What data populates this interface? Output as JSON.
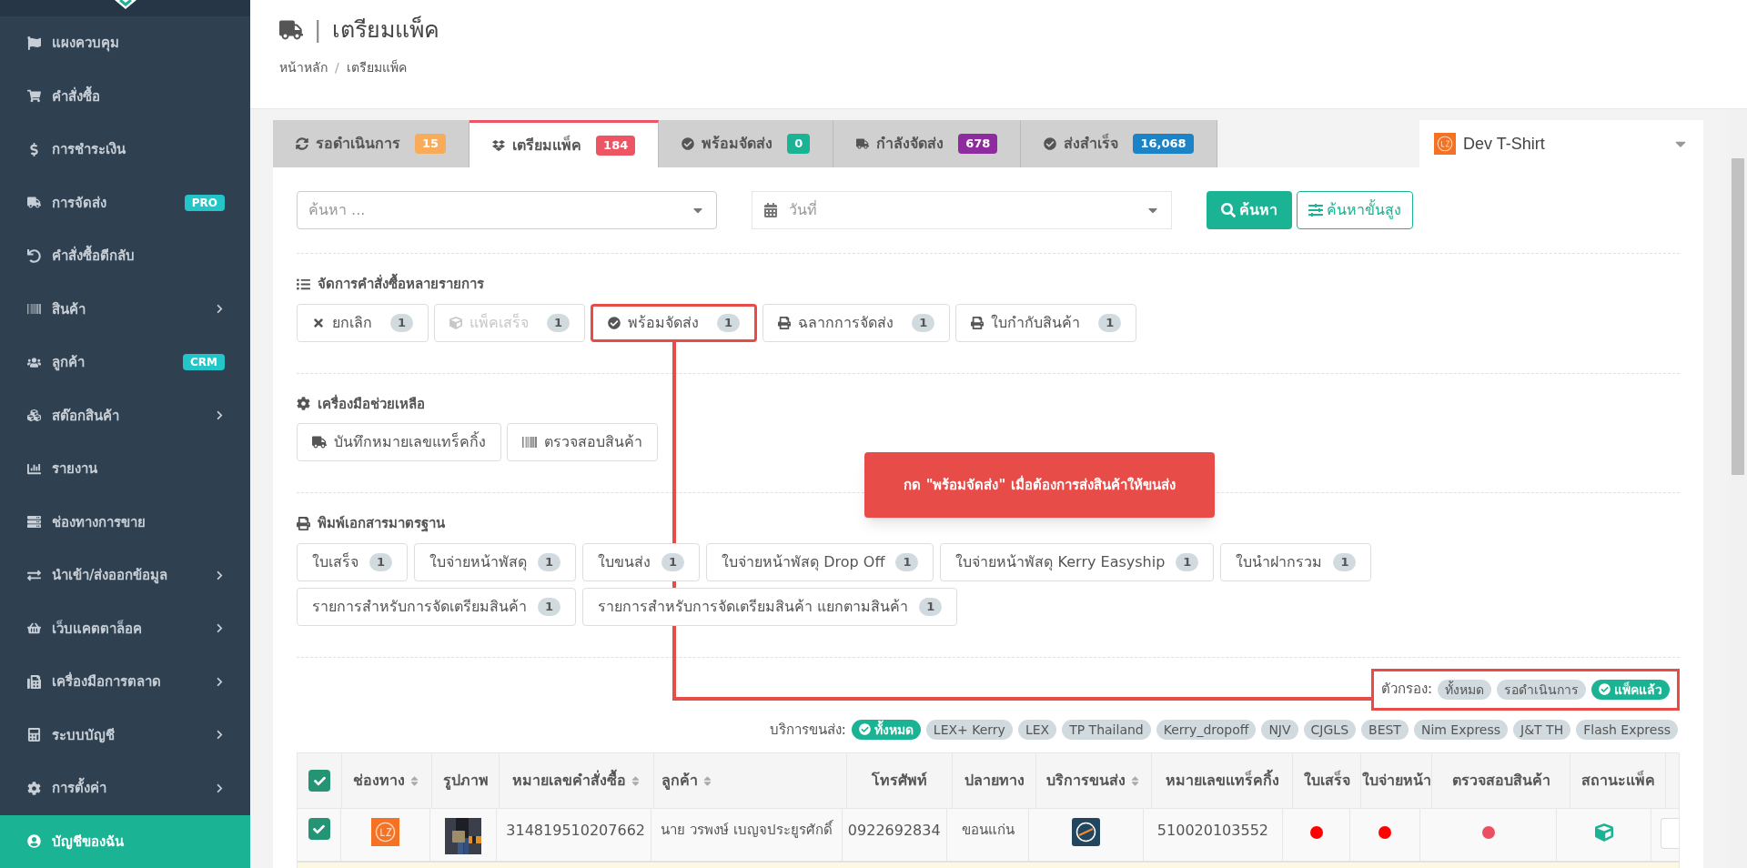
{
  "sidebar": {
    "items": [
      {
        "label": "แผงควบคุม",
        "selected": false
      },
      {
        "label": "คำสั่งซื้อ",
        "selected": false
      },
      {
        "label": "การชำระเงิน",
        "selected": false
      },
      {
        "label": "การจัดส่ง",
        "badge": "PRO",
        "selected": false
      },
      {
        "label": "คำสั่งซื้อตีกลับ",
        "selected": false
      },
      {
        "label": "สินค้า",
        "submenu": true,
        "selected": false
      },
      {
        "label": "ลูกค้า",
        "badge": "CRM",
        "selected": false
      },
      {
        "label": "สต๊อกสินค้า",
        "submenu": true,
        "selected": false
      },
      {
        "label": "รายงาน",
        "selected": false
      },
      {
        "label": "ช่องทางการขาย",
        "selected": false
      },
      {
        "label": "นำเข้า/ส่งออกข้อมูล",
        "submenu": true,
        "selected": false
      },
      {
        "label": "เว็บแคตตาล็อค",
        "submenu": true,
        "selected": false
      },
      {
        "label": "เครื่องมือการตลาด",
        "submenu": true,
        "selected": false
      },
      {
        "label": "ระบบบัญชี",
        "submenu": true,
        "selected": false
      },
      {
        "label": "การตั้งค่า",
        "submenu": true,
        "selected": false
      },
      {
        "label": "บัญชีของฉัน",
        "selected": true
      }
    ]
  },
  "header": {
    "title": "เตรียมแพ็ค",
    "separator": "|",
    "breadcrumb": [
      "หน้าหลัก",
      "เตรียมแพ็ค"
    ],
    "breadcrumb_separator": "/"
  },
  "tabs": [
    {
      "label": "รอดำเนินการ",
      "count": "15",
      "color": "#f8ac59",
      "selected": false
    },
    {
      "label": "เตรียมแพ็ค",
      "count": "184",
      "color": "#ed5565",
      "selected": true
    },
    {
      "label": "พร้อมจัดส่ง",
      "count": "0",
      "color": "#1ab394",
      "selected": false
    },
    {
      "label": "กำลังจัดส่ง",
      "count": "678",
      "color": "#8e2c9f",
      "selected": false
    },
    {
      "label": "ส่งสำเร็จ",
      "count": "16,068",
      "color": "#1c84c6",
      "selected": false
    }
  ],
  "store_select": {
    "value": "Dev T-Shirt"
  },
  "search": {
    "placeholder": "ค้นหา ...",
    "date_placeholder": "วันที่",
    "search_button": "ค้นหา",
    "advanced_button": "ค้นหาขั้นสูง"
  },
  "bulk_actions": {
    "title": "จัดการคำสั่งซื้อหลายรายการ",
    "buttons": [
      {
        "label": "ยกเลิก",
        "count": "1",
        "disabled": false,
        "highlighted": false
      },
      {
        "label": "แพ็คเสร็จ",
        "count": "1",
        "disabled": true,
        "highlighted": false
      },
      {
        "label": "พร้อมจัดส่ง",
        "count": "1",
        "disabled": false,
        "highlighted": true
      },
      {
        "label": "ฉลากการจัดส่ง",
        "count": "1",
        "disabled": false,
        "highlighted": false
      },
      {
        "label": "ใบกำกับสินค้า",
        "count": "1",
        "disabled": false,
        "highlighted": false
      }
    ]
  },
  "tools": {
    "title": "เครื่องมือช่วยเหลือ",
    "buttons": [
      "บันทึกหมายเลขแทร็คกิ้ง",
      "ตรวจสอบสินค้า"
    ]
  },
  "print": {
    "title": "พิมพ์เอกสารมาตรฐาน",
    "buttons": [
      {
        "label": "ใบเสร็จ",
        "count": "1"
      },
      {
        "label": "ใบจ่ายหน้าพัสดุ",
        "count": "1"
      },
      {
        "label": "ใบขนส่ง",
        "count": "1"
      },
      {
        "label": "ใบจ่ายหน้าพัสดุ Drop Off",
        "count": "1"
      },
      {
        "label": "ใบจ่ายหน้าพัสดุ Kerry Easyship",
        "count": "1"
      },
      {
        "label": "ใบนำฝากรวม",
        "count": "1"
      },
      {
        "label": "รายการสำหรับการจัดเตรียมสินค้า",
        "count": "1"
      },
      {
        "label": "รายการสำหรับการจัดเตรียมสินค้า แยกตามสินค้า",
        "count": "1"
      }
    ]
  },
  "callout": {
    "text": "กด \"พร้อมจัดส่ง\" เมื่อต้องการส่งสินค้าให้ขนส่ง"
  },
  "filter": {
    "label": "ตัวกรอง:",
    "highlighted": true,
    "chips": [
      {
        "label": "ทั้งหมด",
        "selected": false
      },
      {
        "label": "รอดำเนินการ",
        "selected": false
      },
      {
        "label": "แพ็คแล้ว",
        "selected": true
      }
    ]
  },
  "carrier_filter": {
    "label": "บริการขนส่ง:",
    "chips": [
      {
        "label": "ทั้งหมด",
        "selected": true
      },
      {
        "label": "LEX+ Kerry",
        "selected": false
      },
      {
        "label": "LEX",
        "selected": false
      },
      {
        "label": "TP Thailand",
        "selected": false
      },
      {
        "label": "Kerry_dropoff",
        "selected": false
      },
      {
        "label": "NJV",
        "selected": false
      },
      {
        "label": "CJGLS",
        "selected": false
      },
      {
        "label": "BEST",
        "selected": false
      },
      {
        "label": "Nim Express",
        "selected": false
      },
      {
        "label": "J&T TH",
        "selected": false
      },
      {
        "label": "Flash Express",
        "selected": false
      }
    ]
  },
  "table": {
    "all_checked": true,
    "columns": [
      {
        "label": "ช่องทาง",
        "sortable": true
      },
      {
        "label": "รูปภาพ",
        "sortable": false
      },
      {
        "label": "หมายเลขคำสั่งซื้อ",
        "sortable": true
      },
      {
        "label": "ลูกค้า",
        "sortable": true
      },
      {
        "label": "โทรศัพท์",
        "sortable": false
      },
      {
        "label": "ปลายทาง",
        "sortable": false
      },
      {
        "label": "บริการขนส่ง",
        "sortable": true
      },
      {
        "label": "หมายเลขแทร็คกิ้ง",
        "sortable": false
      },
      {
        "label": "ใบเสร็จ",
        "sortable": false
      },
      {
        "label": "ใบจ่ายหน้า",
        "sortable": false
      },
      {
        "label": "ตรวจสอบสินค้า",
        "sortable": false
      },
      {
        "label": "สถานะแพ็ค",
        "sortable": false
      }
    ],
    "rows": [
      {
        "checked": true,
        "order_no": "314819510207662",
        "customer": "นาย วรพงษ์ เบญจประยูรศักดิ์",
        "phone": "0922692834",
        "destination": "ขอนแก่น",
        "tracking": "510020103552",
        "receipt": {
          "color": "#ff0000"
        },
        "label": {
          "color": "#ff0000"
        },
        "inspection": {
          "color": "#ea5062"
        },
        "packed": true
      }
    ]
  }
}
